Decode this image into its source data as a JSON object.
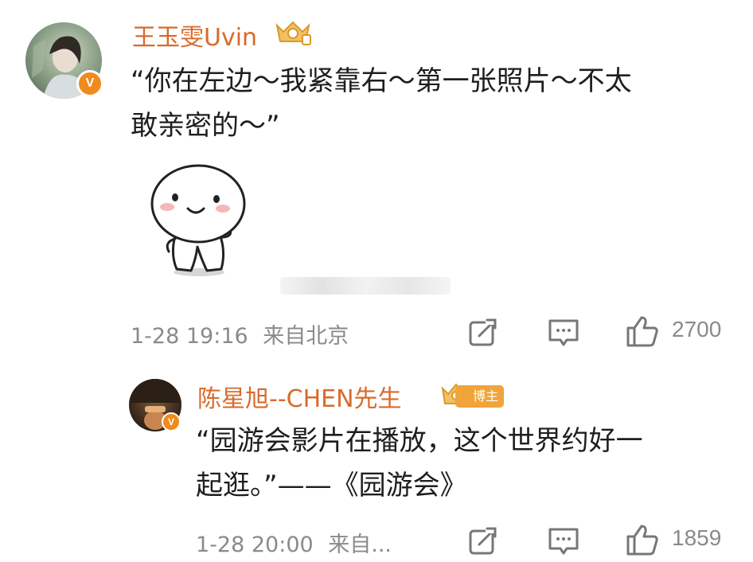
{
  "comments": [
    {
      "username": "王玉雯Uvin",
      "text_line1": "“你在左边～我紧靠右～第一张照片～不太",
      "text_line2": "敢亲密的～”",
      "badge": "V",
      "time": "1-28 19:16",
      "location": "来自北京",
      "likes": "2700"
    },
    {
      "username": "陈星旭--CHEN先生",
      "text_line1": "“园游会影片在播放，这个世界约好一",
      "text_line2": "起逛。”——《园游会》",
      "badge": "V",
      "tag": "博主",
      "time": "1-28 20:00",
      "location": "来自...",
      "likes": "1859"
    }
  ],
  "icons": {
    "repost": "share-icon",
    "comment": "comment-icon",
    "like": "thumbs-up-icon",
    "emoji": "smiling-sticker-icon"
  },
  "colors": {
    "username": "#d96a2b",
    "verified_badge": "#f08a1c",
    "meta_text": "#8a8a8a"
  }
}
